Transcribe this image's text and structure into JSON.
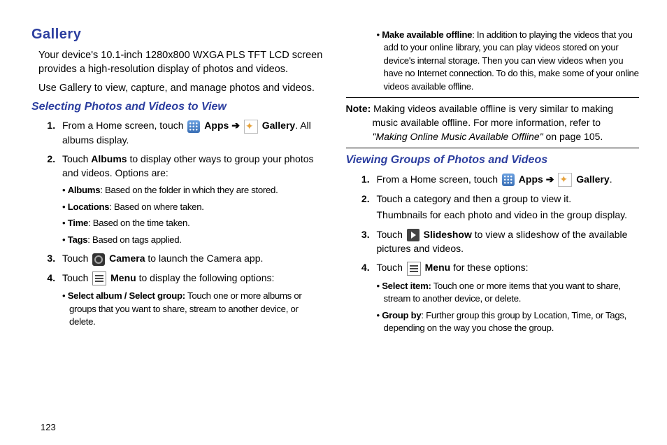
{
  "title": "Gallery",
  "intro1": "Your device's 10.1-inch 1280x800 WXGA PLS TFT LCD screen provides a high-resolution display of photos and videos.",
  "intro2": "Use Gallery to view, capture, and manage photos and videos.",
  "s1_title": "Selecting Photos and Videos to View",
  "s1_i1_a": "From a Home screen, touch ",
  "apps_lbl": "Apps",
  "arrow": " ➔ ",
  "gallery_lbl": "Gallery",
  "s1_i1_b": ". All albums display.",
  "s1_i2_a": "Touch ",
  "albums_lbl": "Albums",
  "s1_i2_b": " to display other ways to group your photos and videos. Options are:",
  "opt_albums_h": "Albums",
  "opt_albums_t": ": Based on the folder in which they are stored.",
  "opt_loc_h": "Locations",
  "opt_loc_t": ": Based on where taken.",
  "opt_time_h": "Time",
  "opt_time_t": ": Based on the time taken.",
  "opt_tags_h": "Tags",
  "opt_tags_t": ": Based on tags applied.",
  "s1_i3_a": "Touch ",
  "camera_lbl": "Camera",
  "s1_i3_b": " to launch the Camera app.",
  "s1_i4_a": "Touch ",
  "menu_lbl": "Menu",
  "s1_i4_b": " to display the following options:",
  "sub_sel_h": "Select album / Select group:",
  "sub_sel_t": " Touch one or more albums or groups that you want to share, stream to another device, or delete.",
  "sub_off_h": "Make available offline",
  "sub_off_t": ": In addition to playing the videos that you add to your online library, you can play videos stored on your device's internal storage. Then you can view videos when you have no Internet connection. To do this, make some of your online videos available offline.",
  "note_lbl": "Note:",
  "note_t1": " Making videos available offline is very similar to making music available offline. For more information, refer to ",
  "note_ref": "\"Making Online Music Available Offline\"",
  "note_t2": " on page 105.",
  "s2_title": "Viewing Groups of Photos and Videos",
  "s2_i1_a": "From a Home screen, touch ",
  "s2_i2": "Touch a category and then a group to view it.",
  "s2_i2b": "Thumbnails for each photo and video in the group display.",
  "s2_i3_a": "Touch ",
  "slideshow_lbl": "Slideshow",
  "s2_i3_b": " to view a slideshow of the available pictures and videos.",
  "s2_i4_a": "Touch ",
  "s2_i4_b": " for these options:",
  "sub_selitem_h": "Select item:",
  "sub_selitem_t": " Touch one or more items that you want to share, stream to another device, or delete.",
  "sub_group_h": "Group by",
  "sub_group_t": ": Further group this group by Location, Time, or Tags, depending on the way you chose the group.",
  "page_num": "123"
}
